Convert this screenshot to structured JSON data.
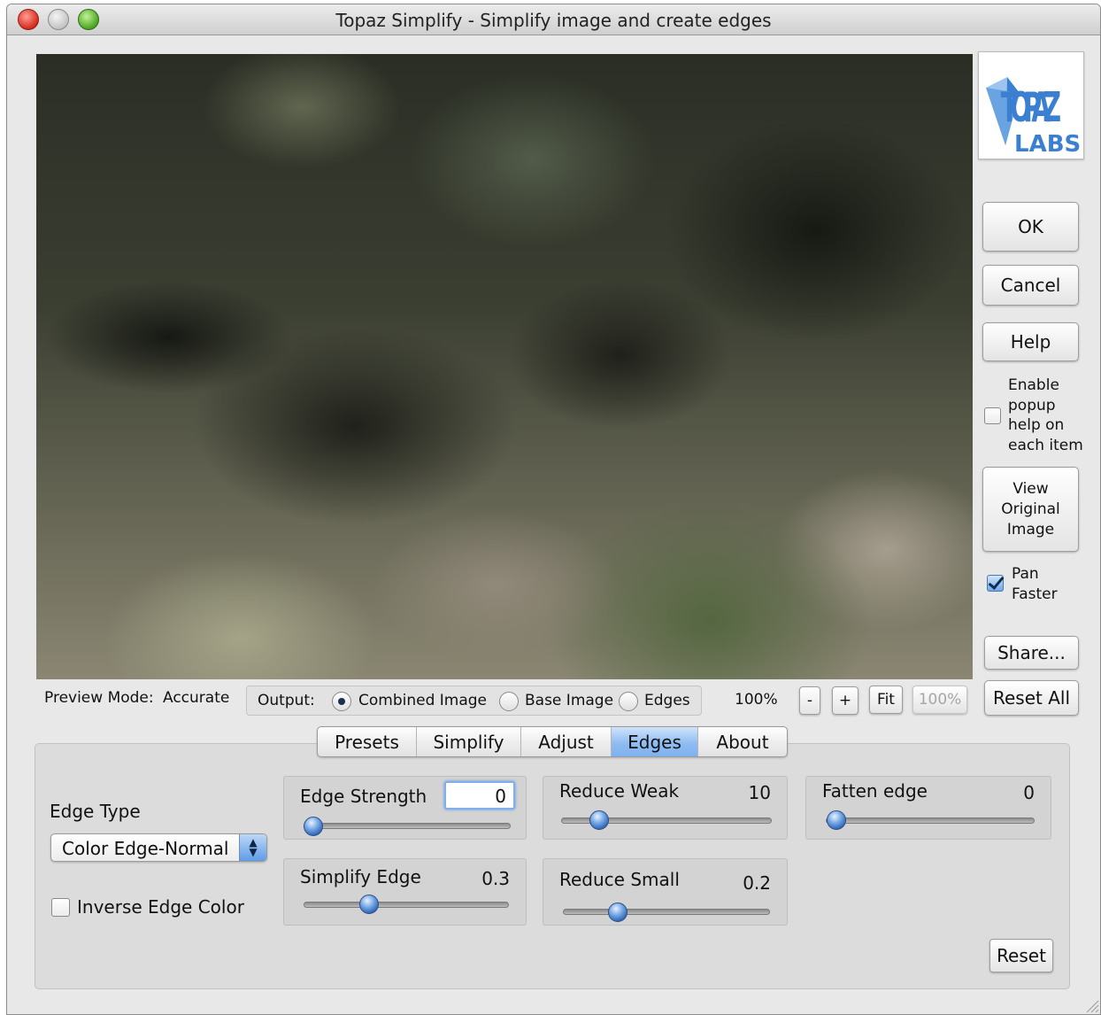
{
  "window": {
    "title": "Topaz Simplify - Simplify image and create edges"
  },
  "logo": {
    "icon": "topaz-labs-logo",
    "text_top": "TOPAZ",
    "text_bottom": "LABS",
    "color": "#3b7fd1"
  },
  "side_buttons": {
    "ok": "OK",
    "cancel": "Cancel",
    "help": "Help",
    "popup_help_label": "Enable\npopup\nhelp on\neach item",
    "popup_help_checked": false,
    "view_original": "View\nOriginal\nImage",
    "pan_faster_label": "Pan\nFaster",
    "pan_faster_checked": true,
    "share": "Share...",
    "reset_all": "Reset All"
  },
  "preview_bar": {
    "preview_mode_label": "Preview Mode:",
    "preview_mode_value": "Accurate",
    "output_label": "Output:",
    "output_options": [
      "Combined Image",
      "Base Image",
      "Edges"
    ],
    "output_selected": "Combined Image",
    "zoom_level": "100%",
    "zoom_out": "-",
    "zoom_in": "+",
    "fit": "Fit",
    "zoom_100": "100%"
  },
  "tabs": {
    "items": [
      "Presets",
      "Simplify",
      "Adjust",
      "Edges",
      "About"
    ],
    "active": "Edges"
  },
  "edges_panel": {
    "edge_type_label": "Edge Type",
    "edge_type_value": "Color Edge-Normal",
    "inverse_edge_color_label": "Inverse Edge Color",
    "inverse_edge_color_checked": false,
    "edge_strength": {
      "label": "Edge Strength",
      "value": "0",
      "fraction": 0.0
    },
    "simplify_edge": {
      "label": "Simplify Edge",
      "value": "0.3",
      "fraction": 0.3
    },
    "reduce_weak": {
      "label": "Reduce Weak",
      "value": "10",
      "fraction": 0.15
    },
    "reduce_small": {
      "label": "Reduce Small",
      "value": "0.2",
      "fraction": 0.24
    },
    "fatten_edge": {
      "label": "Fatten edge",
      "value": "0",
      "fraction": 0.0
    },
    "reset": "Reset"
  }
}
